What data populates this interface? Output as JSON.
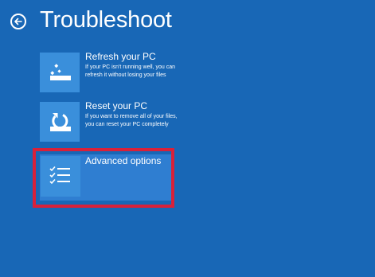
{
  "header": {
    "title": "Troubleshoot",
    "back_icon": "back-arrow-icon"
  },
  "options": [
    {
      "title": "Refresh your PC",
      "description": "If your PC isn't running well, you can refresh it without losing your files",
      "icon": "refresh-pc-icon"
    },
    {
      "title": "Reset your PC",
      "description": "If you want to remove all of your files, you can reset your PC completely",
      "icon": "reset-pc-icon"
    },
    {
      "title": "Advanced options",
      "description": "",
      "icon": "checklist-icon"
    }
  ],
  "colors": {
    "background": "#1867b6",
    "tile": "#3a8fdb",
    "selected_item": "#2f7ed1",
    "highlight_frame": "#d8213a",
    "text": "#ffffff"
  }
}
